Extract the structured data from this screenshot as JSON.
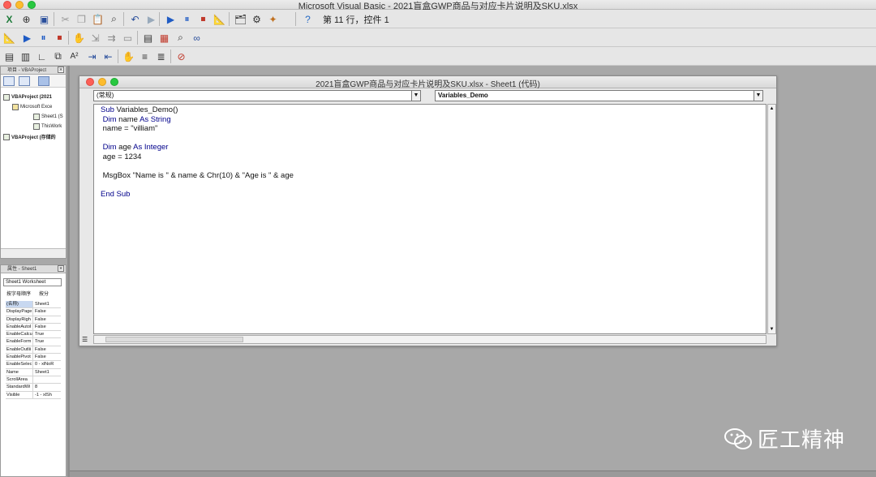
{
  "window": {
    "title": "Microsoft Visual Basic - 2021盲盒GWP商品与对应卡片说明及SKU.xlsx"
  },
  "toolbar": {
    "status_text": "第 11 行，控件 1",
    "icons_row1": [
      "excel-icon",
      "insert-module-icon",
      "save-icon",
      "cut-icon",
      "copy-icon",
      "paste-icon",
      "find-icon",
      "undo-icon",
      "redo-icon",
      "run-icon",
      "pause-icon",
      "stop-icon",
      "design-mode-icon",
      "project-explorer-icon",
      "properties-icon",
      "toolbox-icon",
      "help-icon"
    ],
    "icons_row2": [
      "design-mode-icon",
      "run-icon",
      "pause-icon",
      "stop-icon",
      "toggle-breakpoint-icon",
      "step-into-icon",
      "step-over-icon",
      "locals-icon",
      "immediate-icon",
      "watch-icon",
      "quick-watch-icon",
      "call-stack-icon"
    ],
    "icons_row3": [
      "list-properties-icon",
      "list-constants-icon",
      "quick-info-icon",
      "parameter-info-icon",
      "complete-word-icon",
      "indent-icon",
      "outdent-icon",
      "toggle-breakpoint-icon",
      "comment-block-icon",
      "uncomment-block-icon",
      "clear-bookmarks-icon"
    ]
  },
  "project_panel": {
    "title": "项目 - VBAProject",
    "close": "×",
    "tree": [
      {
        "label": "VBAProject (2021",
        "level": 0
      },
      {
        "label": "Microsoft Exce",
        "level": 1
      },
      {
        "label": "Sheet1 (S",
        "level": 2
      },
      {
        "label": "ThisWork",
        "level": 2
      },
      {
        "label": "VBAProject (存储的",
        "level": 0
      }
    ]
  },
  "properties_panel": {
    "title": "属性 - Sheet1",
    "close": "×",
    "object_select": "Sheet1  Worksheet",
    "tab_alpha": "按字母顺序",
    "tab_category": "按分",
    "rows": [
      {
        "key": "(名称)",
        "value": "Sheet1"
      },
      {
        "key": "DisplayPage",
        "value": "False"
      },
      {
        "key": "DisplayRigh",
        "value": "False"
      },
      {
        "key": "EnableAutoI",
        "value": "False"
      },
      {
        "key": "EnableCalcu",
        "value": "True"
      },
      {
        "key": "EnableForm",
        "value": "True"
      },
      {
        "key": "EnableOutlii",
        "value": "False"
      },
      {
        "key": "EnablePivot",
        "value": "False"
      },
      {
        "key": "EnableSelec",
        "value": "0 - xlNoR"
      },
      {
        "key": "Name",
        "value": "Sheet1"
      },
      {
        "key": "ScrollArea",
        "value": ""
      },
      {
        "key": "StandardWi",
        "value": "8"
      },
      {
        "key": "Visible",
        "value": "-1 - xlSh"
      }
    ]
  },
  "code_window": {
    "title": "2021盲盒GWP商品与对应卡片说明及SKU.xlsx - Sheet1 (代码)",
    "object_combo": "(常规)",
    "procedure_combo": "Variables_Demo",
    "code_lines": [
      [
        {
          "t": "Sub",
          "k": true
        },
        {
          "t": " Variables_Demo()",
          "k": false
        }
      ],
      [
        {
          "t": " ",
          "k": false
        },
        {
          "t": "Dim",
          "k": true
        },
        {
          "t": " name ",
          "k": false
        },
        {
          "t": "As String",
          "k": true
        }
      ],
      [
        {
          "t": " name = \"villiam\"",
          "k": false
        }
      ],
      [
        {
          "t": "",
          "k": false
        }
      ],
      [
        {
          "t": " ",
          "k": false
        },
        {
          "t": "Dim",
          "k": true
        },
        {
          "t": " age ",
          "k": false
        },
        {
          "t": "As Integer",
          "k": true
        }
      ],
      [
        {
          "t": " age = 1234",
          "k": false
        }
      ],
      [
        {
          "t": "",
          "k": false
        }
      ],
      [
        {
          "t": " MsgBox \"Name is \" & name & Chr(10) & \"Age is \" & age",
          "k": false
        }
      ],
      [
        {
          "t": "",
          "k": false
        }
      ],
      [
        {
          "t": "End Sub",
          "k": true
        }
      ]
    ]
  },
  "watermark": {
    "text": "匠工精神"
  },
  "colors": {
    "keyword": "#00008b",
    "background": "#a8a8a8"
  }
}
